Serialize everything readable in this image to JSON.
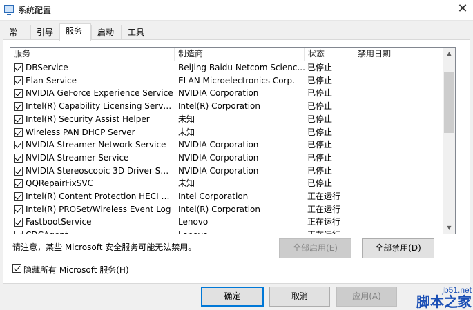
{
  "window": {
    "title": "系统配置",
    "close_glyph": "✕"
  },
  "tabs": [
    {
      "label": "常规",
      "active": false
    },
    {
      "label": "引导",
      "active": false
    },
    {
      "label": "服务",
      "active": true
    },
    {
      "label": "启动",
      "active": false
    },
    {
      "label": "工具",
      "active": false
    }
  ],
  "list": {
    "columns": {
      "service": "服务",
      "manufacturer": "制造商",
      "status": "状态",
      "disabled_date": "禁用日期"
    },
    "sort_indicator": "^",
    "rows": [
      {
        "checked": true,
        "name": "DBService",
        "manufacturer": "BeiJing Baidu Netcom Scienc...",
        "status": "已停止"
      },
      {
        "checked": true,
        "name": "Elan Service",
        "manufacturer": "ELAN Microelectronics Corp.",
        "status": "已停止"
      },
      {
        "checked": true,
        "name": "NVIDIA GeForce Experience Service",
        "manufacturer": "NVIDIA Corporation",
        "status": "已停止"
      },
      {
        "checked": true,
        "name": "Intel(R) Capability Licensing Service ...",
        "manufacturer": "Intel(R) Corporation",
        "status": "已停止"
      },
      {
        "checked": true,
        "name": "Intel(R) Security Assist Helper",
        "manufacturer": "未知",
        "status": "已停止"
      },
      {
        "checked": true,
        "name": "Wireless PAN DHCP Server",
        "manufacturer": "未知",
        "status": "已停止"
      },
      {
        "checked": true,
        "name": "NVIDIA Streamer Network Service",
        "manufacturer": "NVIDIA Corporation",
        "status": "已停止"
      },
      {
        "checked": true,
        "name": "NVIDIA Streamer Service",
        "manufacturer": "NVIDIA Corporation",
        "status": "已停止"
      },
      {
        "checked": true,
        "name": "NVIDIA Stereoscopic 3D Driver Servi...",
        "manufacturer": "NVIDIA Corporation",
        "status": "已停止"
      },
      {
        "checked": true,
        "name": "QQRepairFixSVC",
        "manufacturer": "未知",
        "status": "已停止"
      },
      {
        "checked": true,
        "name": "Intel(R) Content Protection HECI Ser...",
        "manufacturer": "Intel Corporation",
        "status": "正在运行"
      },
      {
        "checked": true,
        "name": "Intel(R) PROSet/Wireless Event Log",
        "manufacturer": "Intel(R) Corporation",
        "status": "正在运行"
      },
      {
        "checked": true,
        "name": "FastbootService",
        "manufacturer": "Lenovo",
        "status": "正在运行"
      },
      {
        "checked": true,
        "name": "CDCAgent",
        "manufacturer": "Lenovo",
        "status": "正在运行"
      }
    ]
  },
  "note": "请注意，某些 Microsoft 安全服务可能无法禁用。",
  "buttons": {
    "enable_all": "全部启用(E)",
    "disable_all": "全部禁用(D)",
    "ok": "确定",
    "cancel": "取消",
    "apply": "应用(A)"
  },
  "hide_ms": {
    "checked": true,
    "label": "隐藏所有 Microsoft 服务(H)"
  },
  "watermark": {
    "site": "jb51.net",
    "brand": "脚本之家"
  },
  "colors": {
    "accent": "#0078d7",
    "watermark": "#1a4fb5"
  }
}
